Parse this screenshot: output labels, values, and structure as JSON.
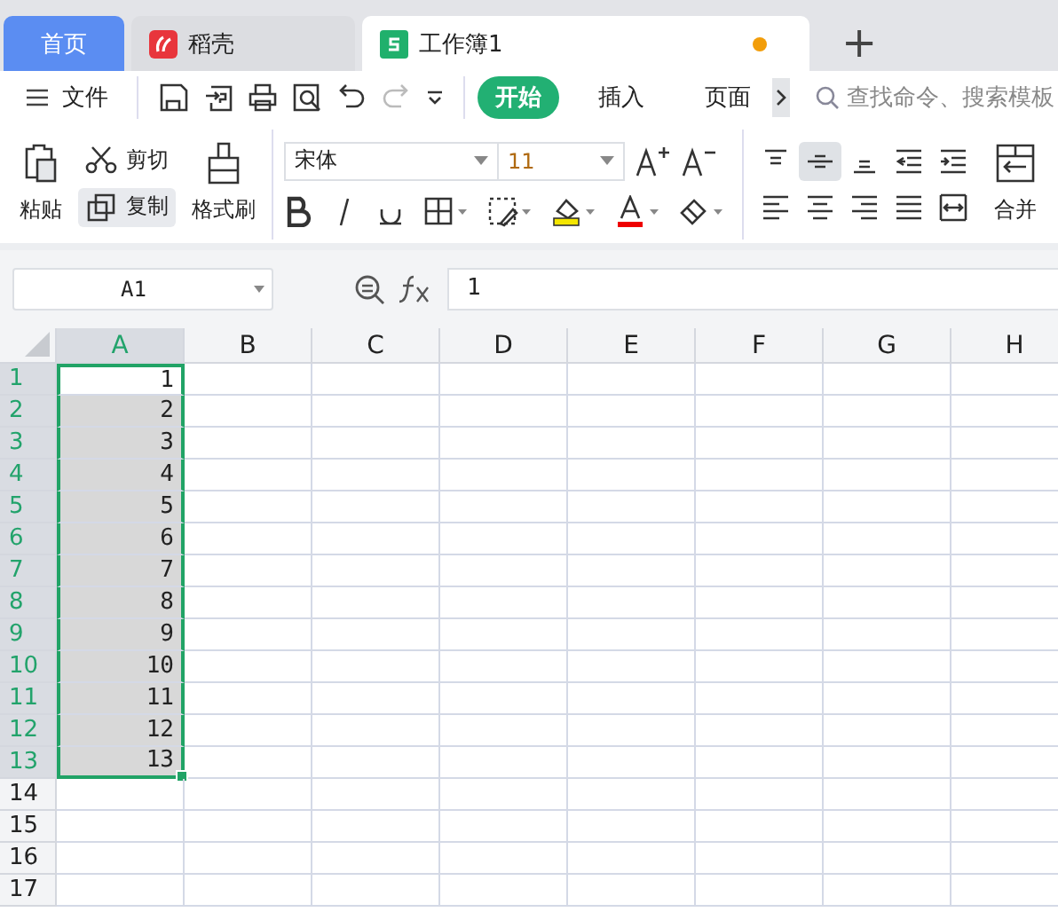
{
  "tabs": [
    {
      "label": "首页",
      "kind": "home",
      "selected": false
    },
    {
      "label": "稻壳",
      "kind": "app",
      "selected": false
    },
    {
      "label": "工作簿1",
      "kind": "sheet",
      "selected": true,
      "unsaved": true
    }
  ],
  "new_tab": "+",
  "quick_bar": {
    "menu": "文件",
    "ribbon_tabs": [
      {
        "label": "开始",
        "selected": true
      },
      {
        "label": "插入",
        "selected": false
      },
      {
        "label": "页面",
        "selected": false
      }
    ],
    "search": {
      "placeholder": "查找命令、搜索模板"
    }
  },
  "ribbon": {
    "paste": "粘贴",
    "cut": "剪切",
    "copy": "复制",
    "format_painter": "格式刷",
    "font_name": "宋体",
    "font_size": "11",
    "align_buttons": [
      {
        "kind": "top",
        "selected": false
      },
      {
        "kind": "middle",
        "selected": true
      },
      {
        "kind": "bottom",
        "selected": false
      },
      {
        "kind": "outdent",
        "selected": false
      },
      {
        "kind": "indent",
        "selected": false
      }
    ],
    "merge": "合并"
  },
  "name_box": "A1",
  "formula": "1",
  "columns": [
    {
      "label": "A",
      "selected": true
    },
    {
      "label": "B",
      "selected": false
    },
    {
      "label": "C",
      "selected": false
    },
    {
      "label": "D",
      "selected": false
    },
    {
      "label": "E",
      "selected": false
    },
    {
      "label": "F",
      "selected": false
    },
    {
      "label": "G",
      "selected": false
    },
    {
      "label": "H",
      "selected": false
    }
  ],
  "rows": [
    {
      "label": "1",
      "value": "1",
      "selected": true,
      "active": true
    },
    {
      "label": "2",
      "value": "2",
      "selected": true,
      "active": false
    },
    {
      "label": "3",
      "value": "3",
      "selected": true,
      "active": false
    },
    {
      "label": "4",
      "value": "4",
      "selected": true,
      "active": false
    },
    {
      "label": "5",
      "value": "5",
      "selected": true,
      "active": false
    },
    {
      "label": "6",
      "value": "6",
      "selected": true,
      "active": false
    },
    {
      "label": "7",
      "value": "7",
      "selected": true,
      "active": false
    },
    {
      "label": "8",
      "value": "8",
      "selected": true,
      "active": false
    },
    {
      "label": "9",
      "value": "9",
      "selected": true,
      "active": false
    },
    {
      "label": "10",
      "value": "10",
      "selected": true,
      "active": false
    },
    {
      "label": "11",
      "value": "11",
      "selected": true,
      "active": false
    },
    {
      "label": "12",
      "value": "12",
      "selected": true,
      "active": false
    },
    {
      "label": "13",
      "value": "13",
      "selected": true,
      "active": false
    },
    {
      "label": "14",
      "selected": false
    },
    {
      "label": "15",
      "selected": false
    },
    {
      "label": "16",
      "selected": false
    },
    {
      "label": "17",
      "selected": false
    }
  ]
}
